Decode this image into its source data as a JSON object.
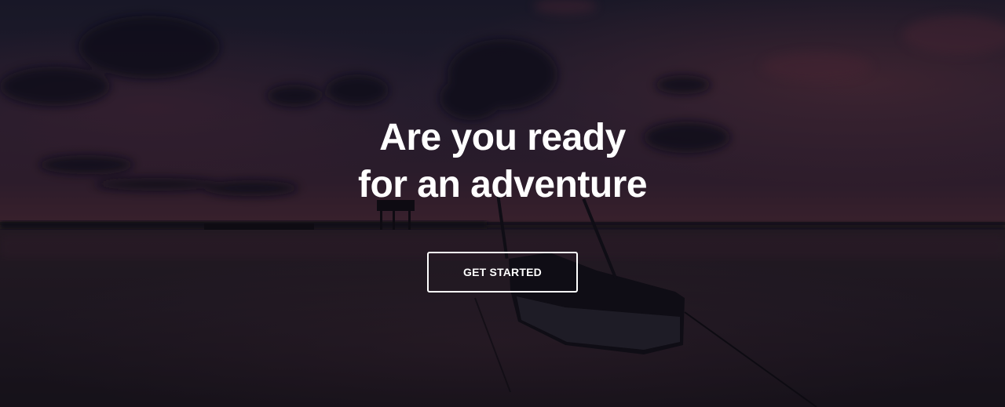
{
  "hero": {
    "headline_line1": "Are you ready",
    "headline_line2": "for an adventure",
    "cta_label": "GET STARTED",
    "background_image": "dusk-lake-boat-photo"
  },
  "colors": {
    "text": "#ffffff",
    "overlay": "#1a1520",
    "sky_dark": "#1b1a2c",
    "sky_glow": "#5a2c3a",
    "water": "#1e1a24"
  }
}
